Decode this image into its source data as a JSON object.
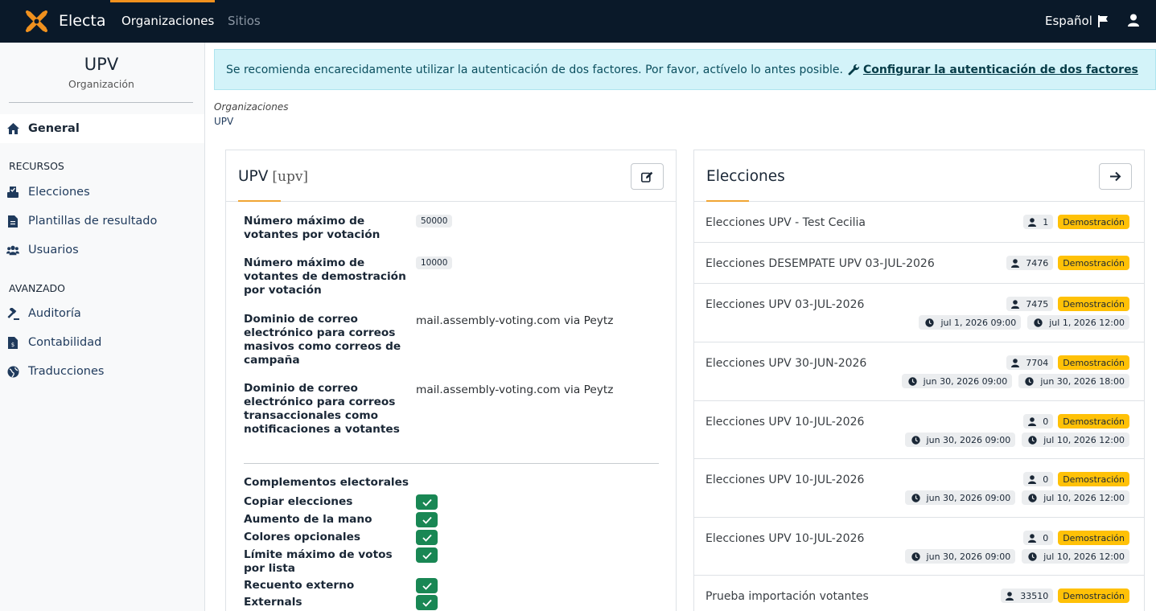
{
  "topnav": {
    "brand": "Electa",
    "orgs_label": "Organizaciones",
    "sites_label": "Sitios",
    "language": "Español"
  },
  "sidebar": {
    "org_name": "UPV",
    "org_sub": "Organización",
    "general": "General",
    "recursos_head": "RECURSOS",
    "elecciones": "Elecciones",
    "plantillas": "Plantillas de resultado",
    "usuarios": "Usuarios",
    "avanzado_head": "AVANZADO",
    "auditoria": "Auditoría",
    "contabilidad": "Contabilidad",
    "traducciones": "Traducciones"
  },
  "alert": {
    "text": "Se recomienda encarecidamente utilizar la autenticación de dos factores. Por favor, actívelo lo antes posible.",
    "link": "Configurar la autenticación de dos factores"
  },
  "breadcrumb": {
    "level1": "Organizaciones",
    "level2": "UPV"
  },
  "org_card": {
    "title": "UPV",
    "slug": "[upv]",
    "props": [
      {
        "label": "Número máximo de votantes por votación",
        "value": "50000"
      },
      {
        "label": "Número máximo de votantes de demostración por votación",
        "value": "10000"
      },
      {
        "label": "Dominio de correo electrónico para correos masivos como correos de campaña",
        "value": "mail.assembly-voting.com via Peytz"
      },
      {
        "label": "Dominio de correo electrónico para correos transaccionales como notificaciones a votantes",
        "value": "mail.assembly-voting.com via Peytz"
      }
    ],
    "plugins_title": "Complementos electorales",
    "plugins": [
      "Copiar elecciones",
      "Aumento de la mano",
      "Colores opcionales",
      "Límite máximo de votos por lista",
      "Recuento externo",
      "Externals"
    ]
  },
  "elections_card": {
    "title": "Elecciones",
    "demo_label": "Demostración",
    "rows": [
      {
        "name": "Elecciones UPV - Test Cecilia",
        "voters": "1",
        "start": "",
        "end": ""
      },
      {
        "name": "Elecciones DESEMPATE UPV 03-JUL-2026",
        "voters": "7476",
        "start": "",
        "end": ""
      },
      {
        "name": "Elecciones UPV 03-JUL-2026",
        "voters": "7475",
        "start": "jul 1, 2026 09:00",
        "end": "jul 1, 2026 12:00"
      },
      {
        "name": "Elecciones UPV 30-JUN-2026",
        "voters": "7704",
        "start": "jun 30, 2026 09:00",
        "end": "jun 30, 2026 18:00"
      },
      {
        "name": "Elecciones UPV 10-JUL-2026",
        "voters": "0",
        "start": "jun 30, 2026 09:00",
        "end": "jul 10, 2026 12:00"
      },
      {
        "name": "Elecciones UPV 10-JUL-2026",
        "voters": "0",
        "start": "jun 30, 2026 09:00",
        "end": "jul 10, 2026 12:00"
      },
      {
        "name": "Elecciones UPV 10-JUL-2026",
        "voters": "0",
        "start": "jun 30, 2026 09:00",
        "end": "jul 10, 2026 12:00"
      },
      {
        "name": "Prueba importación votantes",
        "voters": "33510",
        "start": "",
        "end": ""
      }
    ]
  },
  "colors": {
    "nav_bg": "#0a1929",
    "accent": "#f0911e",
    "demo_badge": "#ffc107",
    "check": "#198754",
    "alert_bg": "#d3f3f9"
  }
}
